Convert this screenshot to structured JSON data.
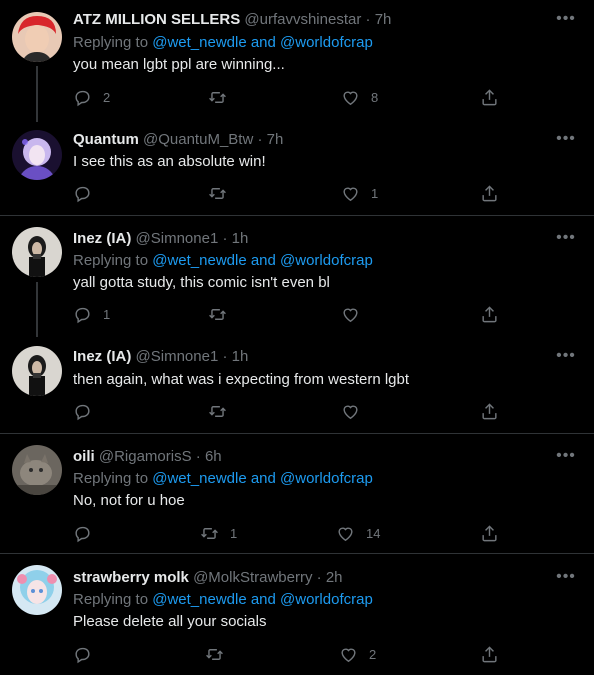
{
  "colors": {
    "background": "#000000",
    "link": "#1d9bf0",
    "muted": "#71767b",
    "text": "#e7e9ea"
  },
  "tweets": [
    {
      "name": "ATZ MILLION SELLERS",
      "handle": "@urfavvshinestar",
      "sep": "·",
      "time": "7h",
      "replying_prefix": "Replying to ",
      "replying_link": "@wet_newdle and @worldofcrap",
      "text": "you mean lgbt ppl are winning...",
      "replies": "2",
      "retweets": "",
      "likes": "8",
      "more_icon": "more-icon"
    },
    {
      "name": "Quantum",
      "handle": "@QuantuM_Btw",
      "sep": "·",
      "time": "7h",
      "text": "I see this as an absolute win!",
      "replies": "",
      "retweets": "",
      "likes": "1"
    },
    {
      "name": "Inez (IA)",
      "handle": "@Simnone1",
      "sep": "·",
      "time": "1h",
      "replying_prefix": "Replying to ",
      "replying_link": "@wet_newdle and @worldofcrap",
      "text": "yall gotta study, this comic isn't even bl",
      "replies": "1",
      "retweets": "",
      "likes": ""
    },
    {
      "name": "Inez (IA)",
      "handle": "@Simnone1",
      "sep": "·",
      "time": "1h",
      "text": "then again, what was i expecting from western lgbt",
      "replies": "",
      "retweets": "",
      "likes": ""
    },
    {
      "name": "oili",
      "handle": "@RigamorisS",
      "sep": "·",
      "time": "6h",
      "replying_prefix": "Replying to ",
      "replying_link": "@wet_newdle and @worldofcrap",
      "text": "No, not for u hoe",
      "replies": "",
      "retweets": "1",
      "likes": "14"
    },
    {
      "name": "strawberry molk",
      "handle": "@MolkStrawberry",
      "sep": "·",
      "time": "2h",
      "replying_prefix": "Replying to ",
      "replying_link": "@wet_newdle and @worldofcrap",
      "text": "Please delete all your socials",
      "replies": "",
      "retweets": "",
      "likes": "2"
    }
  ]
}
